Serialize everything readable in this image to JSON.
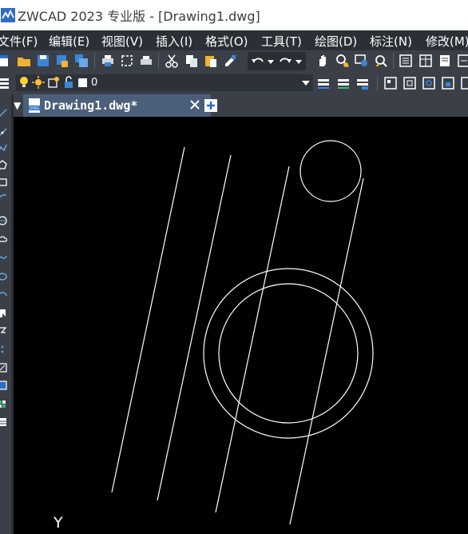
{
  "window": {
    "title": "ZWCAD 2023 专业版 - [Drawing1.dwg]"
  },
  "menu": [
    "文件(F)",
    "编辑(E)",
    "视图(V)",
    "插入(I)",
    "格式(O)",
    "工具(T)",
    "绘图(D)",
    "标注(N)",
    "修改(M)"
  ],
  "layer": {
    "current": "0"
  },
  "tab": {
    "title": "Drawing1.dwg*",
    "icon_label": "DWG"
  },
  "ucs": {
    "y_label": "Y"
  },
  "colors": {
    "background": "#000000",
    "geometry": "#ffffff",
    "accent": "#2f6dc4"
  }
}
